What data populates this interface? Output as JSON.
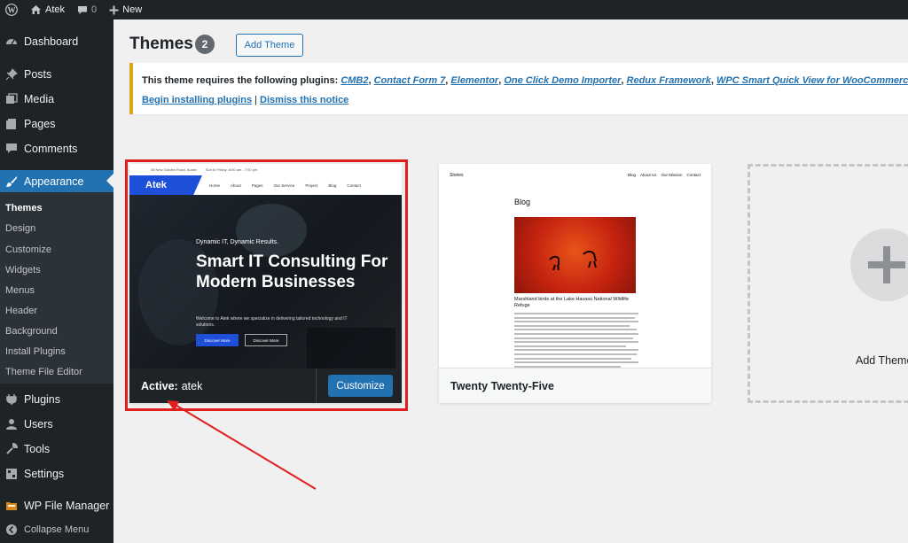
{
  "adminbar": {
    "site_name": "Atek",
    "comments_count": "0",
    "new_label": "New"
  },
  "sidebar": {
    "items": [
      {
        "label": "Dashboard",
        "icon": "dashboard-icon"
      },
      {
        "label": "Posts",
        "icon": "pin-icon"
      },
      {
        "label": "Media",
        "icon": "media-icon"
      },
      {
        "label": "Pages",
        "icon": "pages-icon"
      },
      {
        "label": "Comments",
        "icon": "comment-icon"
      },
      {
        "label": "Appearance",
        "icon": "brush-icon"
      },
      {
        "label": "Plugins",
        "icon": "plugin-icon"
      },
      {
        "label": "Users",
        "icon": "users-icon"
      },
      {
        "label": "Tools",
        "icon": "wrench-icon"
      },
      {
        "label": "Settings",
        "icon": "settings-icon"
      },
      {
        "label": "WP File Manager",
        "icon": "folder-icon"
      },
      {
        "label": "Collapse Menu",
        "icon": "collapse-icon"
      }
    ],
    "appearance_submenu": [
      "Themes",
      "Design",
      "Customize",
      "Widgets",
      "Menus",
      "Header",
      "Background",
      "Install Plugins",
      "Theme File Editor"
    ]
  },
  "page": {
    "title": "Themes",
    "count": "2",
    "add_button": "Add Theme"
  },
  "notice": {
    "prefix": "This theme requires the following plugins:",
    "plugins": [
      "CMB2",
      "Contact Form 7",
      "Elementor",
      "One Click Demo Importer",
      "Redux Framework",
      "WPC Smart Quick View for WooCommerce"
    ],
    "begin_link": "Begin installing plugins",
    "separator": "|",
    "dismiss_link": "Dismiss this notice"
  },
  "themes": [
    {
      "active_label": "Active:",
      "name": "atek",
      "customize_button": "Customize",
      "screenshot": {
        "logo": "Atek",
        "topbar_address": "35 New Garden Road, Austin",
        "topbar_hours": "Sun to Friday: 8:00 am - 7:00 pm",
        "menu": [
          "Home",
          "About",
          "Pages",
          "Our Service",
          "Project",
          "Blog",
          "Contact"
        ],
        "tagline": "Dynamic IT, Dynamic Results.",
        "headline": "Smart IT Consulting For Modern Businesses",
        "body": "Welcome to Atek where we specialize in delivering tailored technology and IT solutions.",
        "btn_primary": "Discover More",
        "btn_secondary": "Discover More"
      }
    },
    {
      "name": "Twenty Twenty-Five",
      "screenshot": {
        "site": "Stories",
        "nav": [
          "Blog",
          "About Us",
          "Our Mission",
          "Contact"
        ],
        "heading": "Blog",
        "caption": "Marshland birds at the Lake Havasu National Wildlife Refuge"
      }
    }
  ],
  "add_theme_card": {
    "label": "Add Theme"
  },
  "colors": {
    "admin_dark": "#1d2327",
    "accent": "#2271b1",
    "highlight_red": "#e01e1e",
    "notice_border": "#dba617"
  }
}
